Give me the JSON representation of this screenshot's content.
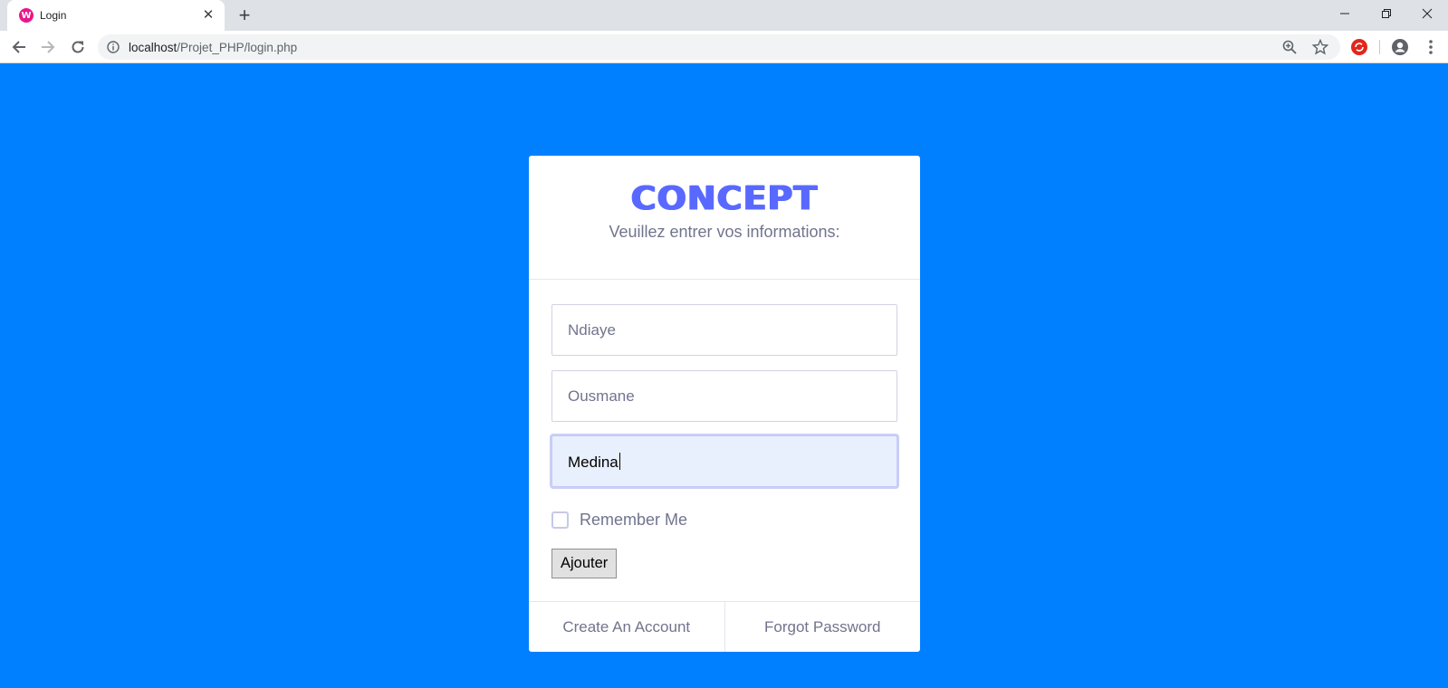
{
  "browser": {
    "tab_title": "Login",
    "favicon_letter": "W",
    "url_host": "localhost",
    "url_path": "/Projet_PHP/login.php",
    "tab_close_glyph": "✕",
    "new_tab_glyph": "+",
    "window_min_glyph": "—",
    "window_restore_glyph": "❐",
    "window_close_glyph": "✕",
    "icons": [
      "back-arrow-icon",
      "forward-arrow-icon",
      "reload-icon",
      "info-icon",
      "zoom-icon",
      "star-icon",
      "extension-icon",
      "profile-icon",
      "menu-icon"
    ]
  },
  "page": {
    "background": "#0080ff",
    "logo_text": "CONCEPT",
    "logo_color": "#5969ff",
    "subtitle": "Veuillez entrer vos informations:",
    "fields": [
      {
        "value": "Ndiaye"
      },
      {
        "value": "Ousmane"
      },
      {
        "value": "Medina",
        "focused": true
      }
    ],
    "remember_label": "Remember Me",
    "remember_checked": false,
    "submit_label": "Ajouter",
    "footer": {
      "create_account": "Create An Account",
      "forgot_password": "Forgot Password"
    }
  }
}
